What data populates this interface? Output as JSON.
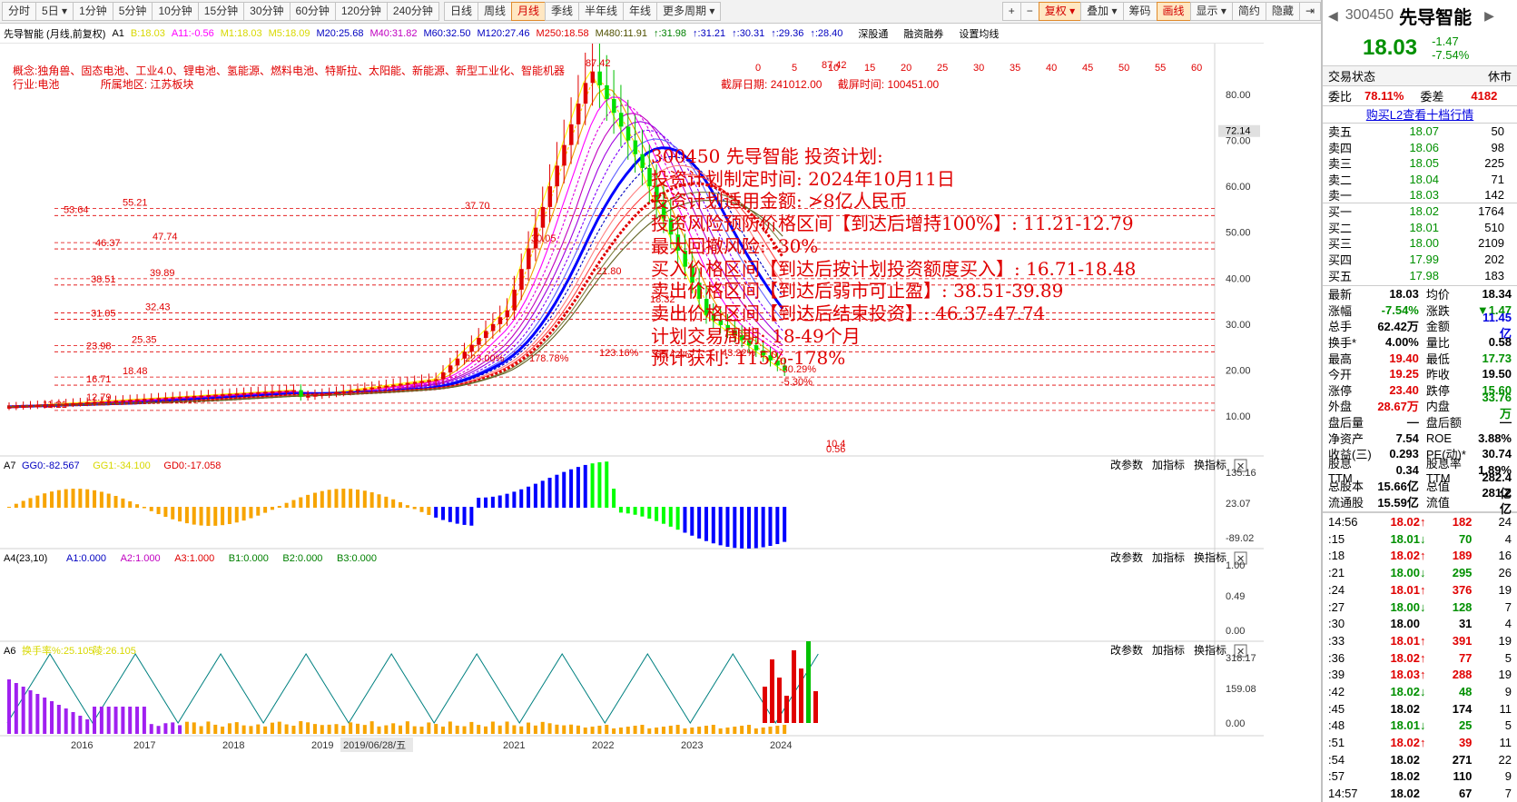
{
  "toolbar": {
    "periods": [
      "分时",
      "5日",
      "1分钟",
      "5分钟",
      "10分钟",
      "15分钟",
      "30分钟",
      "60分钟",
      "120分钟",
      "240分钟",
      "日线",
      "周线",
      "月线",
      "季线",
      "半年线",
      "年线",
      "更多周期"
    ],
    "active": "月线",
    "right": [
      "+",
      "−",
      "复权",
      "叠加",
      "筹码",
      "画线",
      "显示",
      "简约",
      "隐藏"
    ],
    "active_right": [
      "复权",
      "画线"
    ]
  },
  "stock": {
    "code": "300450",
    "name": "先导智能",
    "price": "18.03",
    "change": "-1.47",
    "pct": "-7.54%"
  },
  "title_bar": {
    "name": "先导智能 (月线,前复权)",
    "indicators": [
      "A1",
      "B:18.03",
      "A11:-0.56",
      "M1:18.03",
      "M5:18.09",
      "M20:25.68",
      "M40:31.82",
      "M60:32.50",
      "M120:27.46",
      "M250:18.58",
      "M480:11.91",
      "↑:31.98",
      "↑:31.21",
      "↑:30.31",
      "↑:29.36",
      "↑:28.40"
    ],
    "buttons": [
      "深股通",
      "融资融券",
      "设置均线"
    ]
  },
  "concepts": {
    "line1": "概念:独角兽、固态电池、工业4.0、锂电池、氢能源、燃料电池、特斯拉、太阳能、新能源、新型工业化、智能机器",
    "line2_a": "行业:电池",
    "line2_b": "所属地区: 江苏板块",
    "screen_date_label": "截屏日期:",
    "screen_date": "241012.00",
    "screen_time_label": "截屏时间:",
    "screen_time": "100451.00"
  },
  "plan": [
    "300450 先导智能 投资计划:",
    "投资计划制定时间: 2024年10月11日",
    "投资计划适用金额: ≯8亿人民币",
    "投资风险预防价格区间【到达后增持100%】: 11.21-12.79",
    "最大回撤风险: -30%",
    "买入价格区间【到达后按计划投资额度买入】: 16.71-18.48",
    "卖出价格区间【到达后弱市可止盈】: 38.51-39.89",
    "卖出价格区间【到达后结束投资】: 46.37-47.74",
    "计划交易周期: 18-49个月",
    "预计获利: 115%-178%"
  ],
  "price_levels": {
    "left": [
      "53.64",
      "46.37",
      "38.51",
      "31.05",
      "23.98",
      "16.71",
      "12.79"
    ],
    "right": [
      "55.21",
      "47.74",
      "39.89",
      "32.43",
      "25.35",
      "18.48",
      "11.21"
    ]
  },
  "chart_labels": {
    "high": "87.42",
    "low": "10.4",
    "peak_left": "37.70",
    "mid1": "30.05",
    "mid2": "21.80",
    "mid3": "18.32",
    "mid4": "7.85",
    "pct": [
      "223.00%",
      "178.78%",
      "123.16%",
      "65.42%",
      "43.22%",
      "-30.29%",
      "-5.30%"
    ],
    "last": "0.56",
    "top_ticks": [
      "0",
      "5",
      "10",
      "15",
      "20",
      "25",
      "30",
      "35",
      "40",
      "45",
      "50",
      "55",
      "60"
    ]
  },
  "y_axis": [
    "80.00",
    "72.14",
    "70.00",
    "60.00",
    "50.00",
    "40.00",
    "30.00",
    "20.00",
    "10.00"
  ],
  "x_axis": [
    "2016",
    "2017",
    "2018",
    "2019",
    "2019/06/28/五",
    "2021",
    "2022",
    "2023",
    "2024"
  ],
  "sub_panels": [
    {
      "id": "A7",
      "label": "A7",
      "items": [
        {
          "t": "GG0:-82.567",
          "c": "#0000c0"
        },
        {
          "t": "GG1:-34.100",
          "c": "#d8d800"
        },
        {
          "t": "GD0:-17.058",
          "c": "#e00000"
        }
      ],
      "axis": [
        "135.16",
        "23.07",
        "-89.02"
      ]
    },
    {
      "id": "A4",
      "label": "A4(23,10)",
      "items": [
        {
          "t": "A1:0.000",
          "c": "#0000c0"
        },
        {
          "t": "A2:1.000",
          "c": "#c000c0"
        },
        {
          "t": "A3:1.000",
          "c": "#e00000"
        },
        {
          "t": "B1:0.000",
          "c": "#008000"
        },
        {
          "t": "B2:0.000",
          "c": "#008000"
        },
        {
          "t": "B3:0.000",
          "c": "#008000"
        }
      ],
      "axis": [
        "1.00",
        "0.49",
        "0.00"
      ]
    },
    {
      "id": "A6",
      "label": "A6",
      "items": [
        {
          "t": "换手率%:25.105",
          "c": "#d8d800"
        },
        {
          "t": "陵:26.105",
          "c": "#d8d800"
        }
      ],
      "axis": [
        "318.17",
        "159.08",
        "0.00"
      ]
    }
  ],
  "sub_buttons": [
    "改参数",
    "加指标",
    "换指标"
  ],
  "right_panel": {
    "status_label": "交易状态",
    "status": "休市",
    "wb_label": "委比",
    "wb": "78.11%",
    "wc_label": "委差",
    "wc": "4182",
    "l2": "购买L2查看十档行情",
    "sells": [
      {
        "l": "卖五",
        "p": "18.07",
        "v": "50"
      },
      {
        "l": "卖四",
        "p": "18.06",
        "v": "98"
      },
      {
        "l": "卖三",
        "p": "18.05",
        "v": "225"
      },
      {
        "l": "卖二",
        "p": "18.04",
        "v": "71"
      },
      {
        "l": "卖一",
        "p": "18.03",
        "v": "142"
      }
    ],
    "buys": [
      {
        "l": "买一",
        "p": "18.02",
        "v": "1764"
      },
      {
        "l": "买二",
        "p": "18.01",
        "v": "510"
      },
      {
        "l": "买三",
        "p": "18.00",
        "v": "2109"
      },
      {
        "l": "买四",
        "p": "17.99",
        "v": "202"
      },
      {
        "l": "买五",
        "p": "17.98",
        "v": "183"
      }
    ],
    "stats": [
      [
        "最新",
        "18.03",
        "均价",
        "18.34"
      ],
      [
        "涨幅",
        "-7.54%",
        "涨跌",
        "▼1.47"
      ],
      [
        "总手",
        "62.42万",
        "金额",
        "11.45亿"
      ],
      [
        "换手*",
        "4.00%",
        "量比",
        "0.58"
      ],
      [
        "最高",
        "19.40",
        "最低",
        "17.73"
      ],
      [
        "今开",
        "19.25",
        "昨收",
        "19.50"
      ],
      [
        "涨停",
        "23.40",
        "跌停",
        "15.60"
      ],
      [
        "外盘",
        "28.67万",
        "内盘",
        "33.76万"
      ],
      [
        "盘后量",
        "—",
        "盘后额",
        "—"
      ],
      [
        "净资产",
        "7.54",
        "ROE",
        "3.88%"
      ],
      [
        "收益(三)",
        "0.293",
        "PE(动)*",
        "30.74"
      ],
      [
        "股息TTM",
        "0.34",
        "股息率TTM",
        "1.89%"
      ],
      [
        "总股本",
        "15.66亿",
        "总值",
        "282.4亿"
      ],
      [
        "流通股",
        "15.59亿",
        "流值",
        "281.2亿"
      ]
    ],
    "trades": [
      [
        "14:56",
        "18.02",
        "↑",
        "182",
        "24"
      ],
      [
        ":15",
        "18.01",
        "↓",
        "70",
        "4"
      ],
      [
        ":18",
        "18.02",
        "↑",
        "189",
        "16"
      ],
      [
        ":21",
        "18.00",
        "↓",
        "295",
        "26"
      ],
      [
        ":24",
        "18.01",
        "↑",
        "376",
        "19"
      ],
      [
        ":27",
        "18.00",
        "↓",
        "128",
        "7"
      ],
      [
        ":30",
        "18.00",
        "",
        "31",
        "4"
      ],
      [
        ":33",
        "18.01",
        "↑",
        "391",
        "19"
      ],
      [
        ":36",
        "18.02",
        "↑",
        "77",
        "5"
      ],
      [
        ":39",
        "18.03",
        "↑",
        "288",
        "19"
      ],
      [
        ":42",
        "18.02",
        "↓",
        "48",
        "9"
      ],
      [
        ":45",
        "18.02",
        "",
        "174",
        "11"
      ],
      [
        ":48",
        "18.01",
        "↓",
        "25",
        "5"
      ],
      [
        ":51",
        "18.02",
        "↑",
        "39",
        "11"
      ],
      [
        ":54",
        "18.02",
        "",
        "271",
        "22"
      ],
      [
        ":57",
        "18.02",
        "",
        "110",
        "9"
      ],
      [
        "14:57",
        "18.02",
        "",
        "67",
        "7"
      ]
    ]
  }
}
